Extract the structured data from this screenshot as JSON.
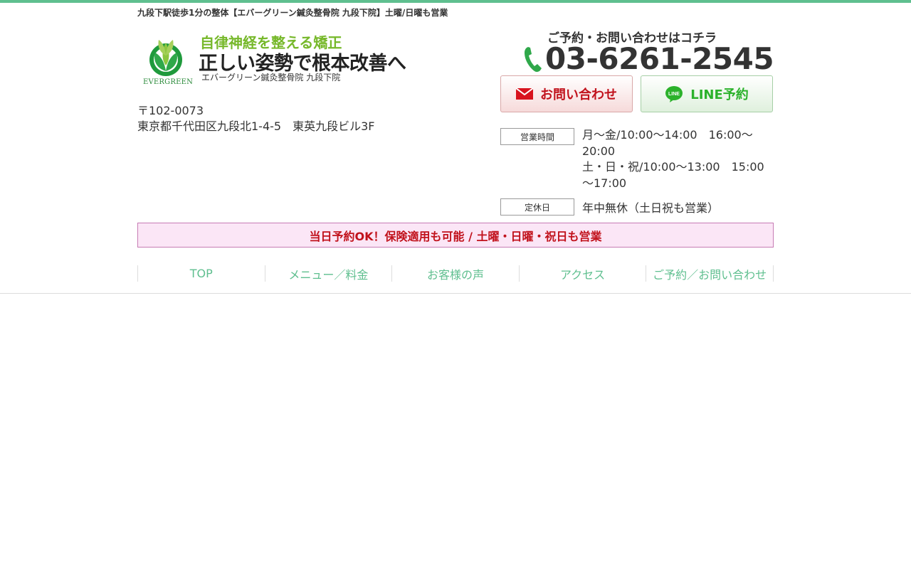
{
  "header": {
    "tagline": "九段下駅徒歩1分の整体【エバーグリーン鍼灸整骨院 九段下院】土曜/日曜も営業"
  },
  "logo": {
    "wordmark": "EVERGREEN",
    "catch_copy": "自律神経を整える矯正",
    "main_copy": "正しい姿勢で根本改善へ",
    "clinic_name": "エバーグリーン鍼灸整骨院 九段下院"
  },
  "address": {
    "postal": "〒102-0073",
    "street": "東京都千代田区九段北1-4-5　東英九段ビル3F"
  },
  "contact": {
    "caption": "ご予約・お問い合わせはコチラ",
    "phone": "03-6261-2545",
    "mail_button": "お問い合わせ",
    "line_button": "LINE予約",
    "line_icon_text": "LINE"
  },
  "hours": {
    "label": "営業時間",
    "weekday": "月～金/10:00～14:00　16:00～20:00",
    "weekend": "土・日・祝/10:00～13:00　15:00～17:00"
  },
  "holiday": {
    "label": "定休日",
    "text": "年中無休（土日祝も営業）"
  },
  "notice": "当日予約OK！保険適用も可能 / 土曜・日曜・祝日も営業",
  "nav": {
    "items": [
      {
        "label": "TOP"
      },
      {
        "label": "メニュー／料金"
      },
      {
        "label": "お客様の声"
      },
      {
        "label": "アクセス"
      },
      {
        "label": "ご予約／お問い合わせ"
      }
    ]
  },
  "colors": {
    "accent": "#5fbf8f",
    "logo_green": "#76b82a",
    "alert_red": "#c1121c",
    "notice_bg": "#fbe6f6"
  }
}
